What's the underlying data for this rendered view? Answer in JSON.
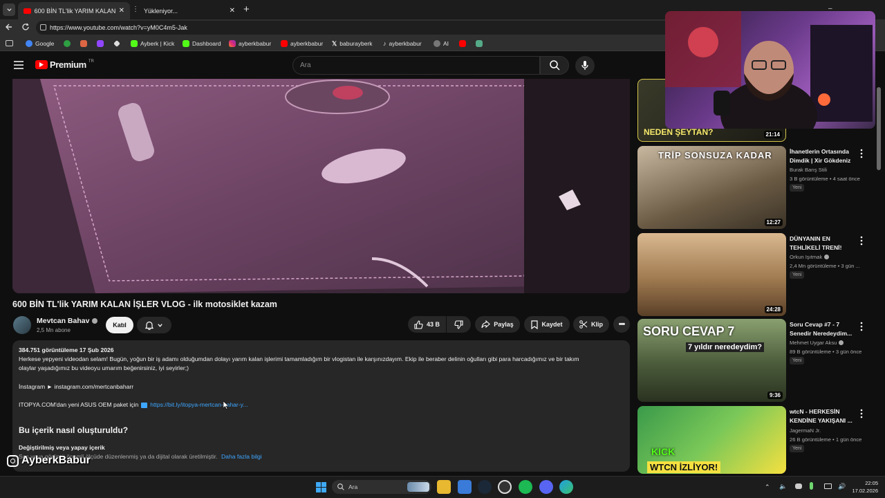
{
  "browser": {
    "tabs": [
      {
        "label": "600 BİN TL'lik YARIM KALAN İŞLER"
      },
      {
        "label": "Yükleniyor..."
      }
    ],
    "url": "https://www.youtube.com/watch?v=yM0C4m5-Jak",
    "bookmarks": [
      "Google",
      "Ayberk | Kick",
      "Dashboard",
      "ayberkbabur",
      "ayberkbabur",
      "baburayberk",
      "ayberkbabur",
      "AI"
    ]
  },
  "youtube": {
    "logo_text": "Premium",
    "logo_region": "TR",
    "search_placeholder": "Ara"
  },
  "video": {
    "title": "600 BİN TL'lik YARIM KALAN İŞLER VLOG - ilk motosiklet kazam",
    "channel": "Mevtcan Bahav",
    "subscribers": "2,5 Mn abone",
    "join_label": "Katıl",
    "likes": "43 B",
    "share_label": "Paylaş",
    "save_label": "Kaydet",
    "clip_label": "Klip"
  },
  "description": {
    "stats": "384.751 görüntüleme  17 Şub 2026",
    "line1": "Herkese yepyeni videodan selam! Bugün, yoğun bir iş adamı olduğumdan dolayı yarım kalan işlerimi tamamladığım bir vlogistan ile karşınızdayım. Ekip ile beraber delinin oğulları gibi para harcadığımız ve bir takım",
    "line2": "olaylar yaşadığımız bu videoyu umarım beğenirsiniz, iyi seyirler;)",
    "instagram": "İnstagram ► instagram.com/mertcanbaharr",
    "itopya_prefix": "ITOPYA.COM'dan yeni ASUS OEM paket için",
    "itopya_link": "https://bit.ly/itopya-mertcan-bahar-y...",
    "section_title": "Bu içerik nasıl oluşturuldu?",
    "altered_title": "Değiştirilmiş veya yapay içerik",
    "altered_text": "Ses veya görüntü önemli ölçüde düzenlenmiş ya da dijital olarak üretilmiştir.",
    "more_info": "Daha fazla bilgi"
  },
  "sidebar": [
    {
      "title": "",
      "channel": "",
      "meta": "",
      "duration": "21:14",
      "thumb_text": "NEDEN ŞEYTAN?",
      "thumb_color": "#2a2a1e"
    },
    {
      "title": "İhanetlerin Ortasında Dimdik | Xir Gökdeniz",
      "channel": "Burak Barış Stili",
      "meta": "3 B görüntüleme • 4 saat önce",
      "badge": "Yeni",
      "duration": "12:27",
      "thumb_text": "TRİP SONSUZA KADAR",
      "thumb_color": "#5a4a3a"
    },
    {
      "title": "DÜNYANIN EN TEHLİKELİ TRENİ!",
      "channel": "Orkun Işıtmak",
      "meta": "2,4 Mn görüntüleme • 3 gün ...",
      "badge": "Yeni",
      "duration": "24:28",
      "thumb_text": "",
      "thumb_color": "#b08a5a"
    },
    {
      "title": "Soru Cevap #7 - 7 Senedir Neredeydim...",
      "channel": "Mehmet Uygar Aksu",
      "meta": "89 B görüntüleme • 3 gün önce",
      "badge": "Yeni",
      "duration": "9:36",
      "thumb_text": "SORU CEVAP 7",
      "thumb_sub": "7 yıldır neredeydim?",
      "thumb_color": "#4a5a3a"
    },
    {
      "title": "wtcN - HERKESİN KENDİNE YAKIŞANI ...",
      "channel": "JagermaN Jr.",
      "meta": "26 B görüntüleme • 1 gün önce",
      "badge": "Yeni",
      "duration": "",
      "thumb_text": "KICK",
      "thumb_sub": "WTCN İZLİYOR!",
      "thumb_color": "#3a8a4a"
    }
  ],
  "overlay": {
    "watermark": "AyberkBabur"
  },
  "taskbar": {
    "search_placeholder": "Ara",
    "time": "22:05",
    "date": "17.02.2026"
  }
}
